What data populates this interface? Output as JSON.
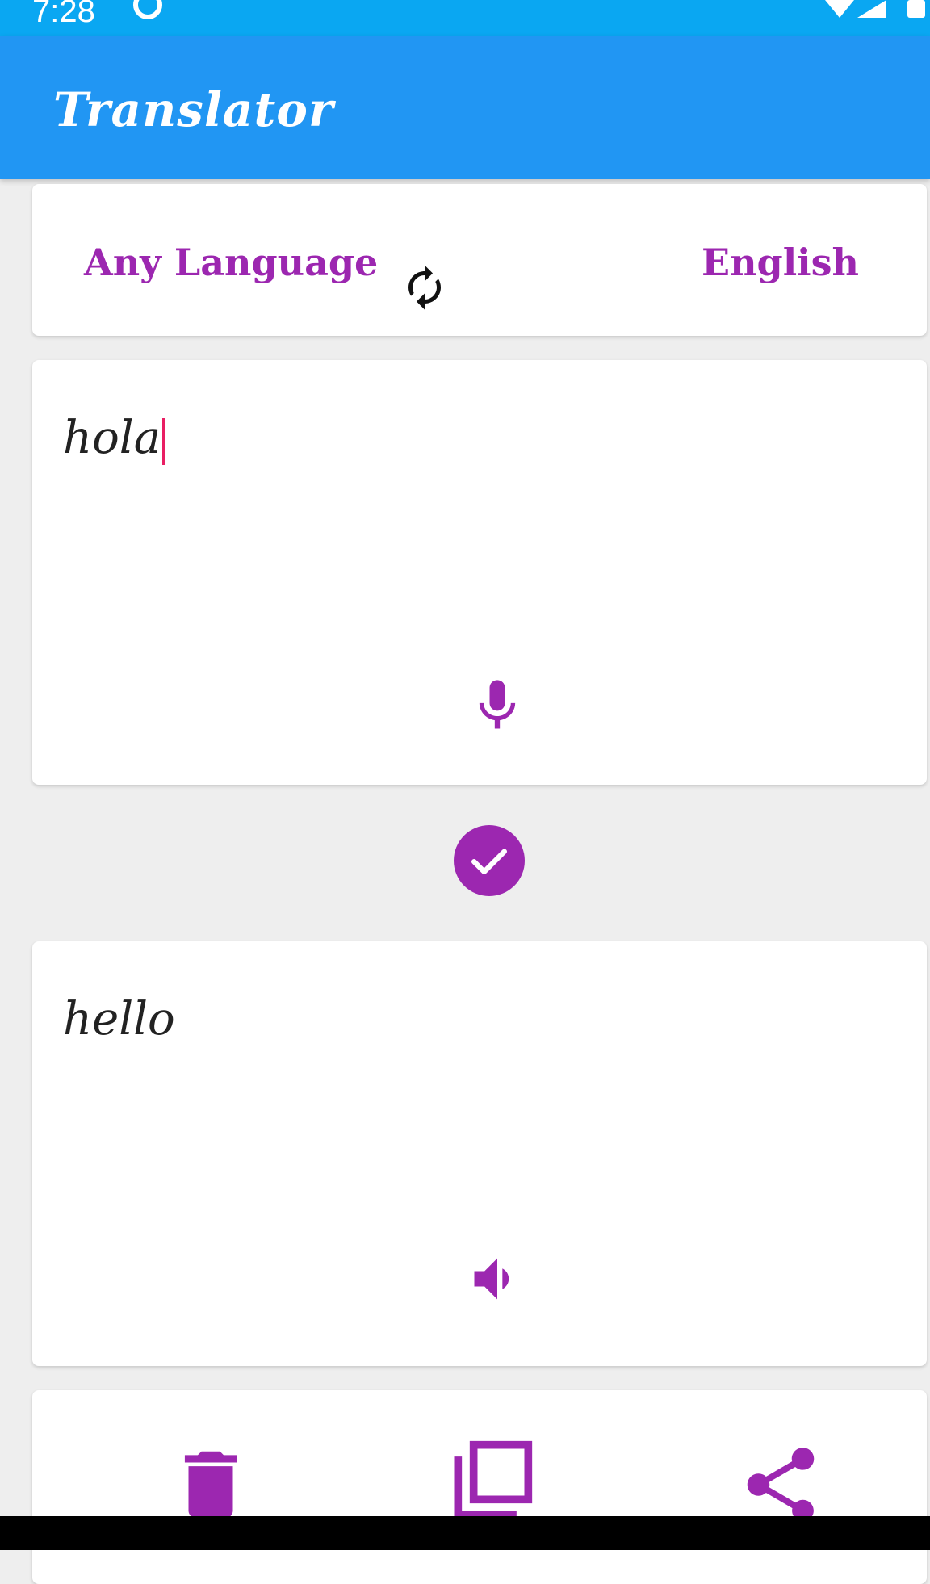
{
  "status_bar": {
    "time": "7:28",
    "icons": [
      "dnd-icon",
      "wifi-icon",
      "signal-icon",
      "battery-icon"
    ]
  },
  "app_bar": {
    "title": "Translator"
  },
  "language_selector": {
    "source_language": "Any Language",
    "target_language": "English",
    "swap_icon": "swap-icon"
  },
  "input": {
    "value": "hola",
    "mic_icon": "microphone-icon"
  },
  "translate": {
    "icon": "check-icon"
  },
  "output": {
    "value": "hello",
    "speaker_icon": "speaker-icon"
  },
  "actions": {
    "icons": [
      "delete-icon",
      "copy-icon",
      "share-icon"
    ]
  },
  "colors": {
    "status_bar": "#0aa7f2",
    "app_bar": "#2196f3",
    "accent": "#9c27b0",
    "background": "#eeeeee",
    "caret": "#e91e63"
  }
}
